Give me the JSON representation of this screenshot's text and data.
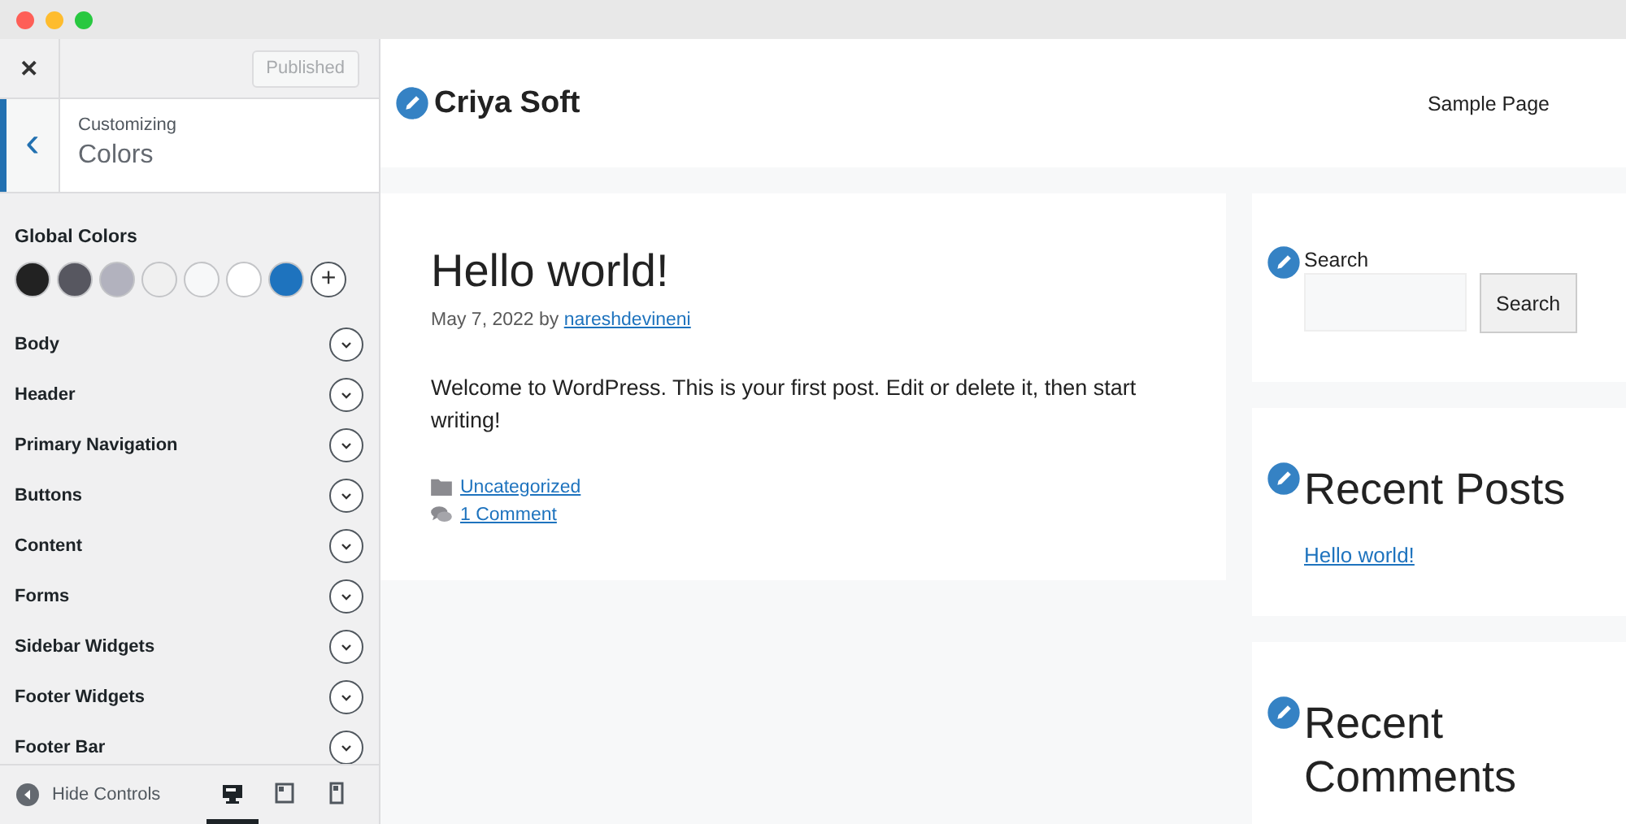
{
  "customizer": {
    "close": "✕",
    "publish_button": "Published",
    "back": "‹",
    "breadcrumb": "Customizing",
    "section_title": "Colors",
    "global_colors": {
      "label": "Global Colors",
      "swatches": [
        {
          "color": "#222222"
        },
        {
          "color": "#575760"
        },
        {
          "color": "#b2b2be"
        },
        {
          "color": "#f0f0f0"
        },
        {
          "color": "#f7f8f9"
        },
        {
          "color": "#ffffff"
        },
        {
          "color": "#1e73be"
        }
      ],
      "add": "+"
    },
    "sections": [
      {
        "label": "Body",
        "expanded": false
      },
      {
        "label": "Header",
        "expanded": false
      },
      {
        "label": "Primary Navigation",
        "expanded": false
      },
      {
        "label": "Buttons",
        "expanded": false
      },
      {
        "label": "Content",
        "expanded": false
      },
      {
        "label": "Forms",
        "expanded": false
      },
      {
        "label": "Sidebar Widgets",
        "expanded": false
      },
      {
        "label": "Footer Widgets",
        "expanded": false
      },
      {
        "label": "Footer Bar",
        "expanded": false
      }
    ],
    "footer": {
      "hide_controls": "Hide Controls",
      "devices": [
        {
          "kind": "desktop",
          "selected": true
        },
        {
          "kind": "tablet",
          "selected": false
        },
        {
          "kind": "mobile",
          "selected": false
        }
      ]
    }
  },
  "preview": {
    "site_title": "Criya Soft",
    "menu": [
      "Sample Page"
    ],
    "post": {
      "title": "Hello world!",
      "date": "May 7, 2022",
      "by": "by",
      "author": "nareshdevineni",
      "body": "Welcome to WordPress. This is your first post. Edit or delete it, then start writing!",
      "category": "Uncategorized",
      "comments": "1 Comment"
    },
    "widgets": [
      {
        "kind": "search",
        "label": "Search",
        "button": "Search"
      },
      {
        "kind": "list",
        "title": "Recent Posts",
        "links": [
          "Hello world!"
        ]
      },
      {
        "kind": "list",
        "title": "Recent Comments"
      }
    ]
  }
}
